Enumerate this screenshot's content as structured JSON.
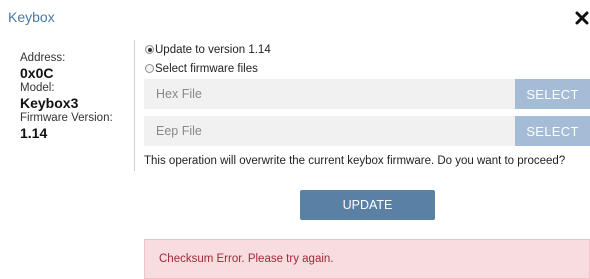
{
  "dialog": {
    "title": "Keybox",
    "close_icon": "close-x-icon"
  },
  "device_info": {
    "address_label": "Address:",
    "address_value": "0x0C",
    "model_label": "Model:",
    "model_value": "Keybox3",
    "firmware_label": "Firmware Version:",
    "firmware_value": "1.14"
  },
  "options": {
    "update_version_label": "Update to version 1.14",
    "update_version_selected": true,
    "select_files_label": "Select firmware files",
    "select_files_selected": false
  },
  "files": {
    "hex_placeholder": "Hex File",
    "hex_value": "",
    "eep_placeholder": "Eep File",
    "eep_value": "",
    "select_label": "SELECT"
  },
  "warning_text": "This operation will overwrite the current keybox firmware. Do you want to proceed?",
  "update_button_label": "UPDATE",
  "error_message": "Checksum Error. Please try again.",
  "colors": {
    "title": "#4a7aa3",
    "select_button": "#a4bcd6",
    "update_button": "#5b80a6",
    "error_background": "#f7dde0",
    "error_text": "#a02a35"
  }
}
